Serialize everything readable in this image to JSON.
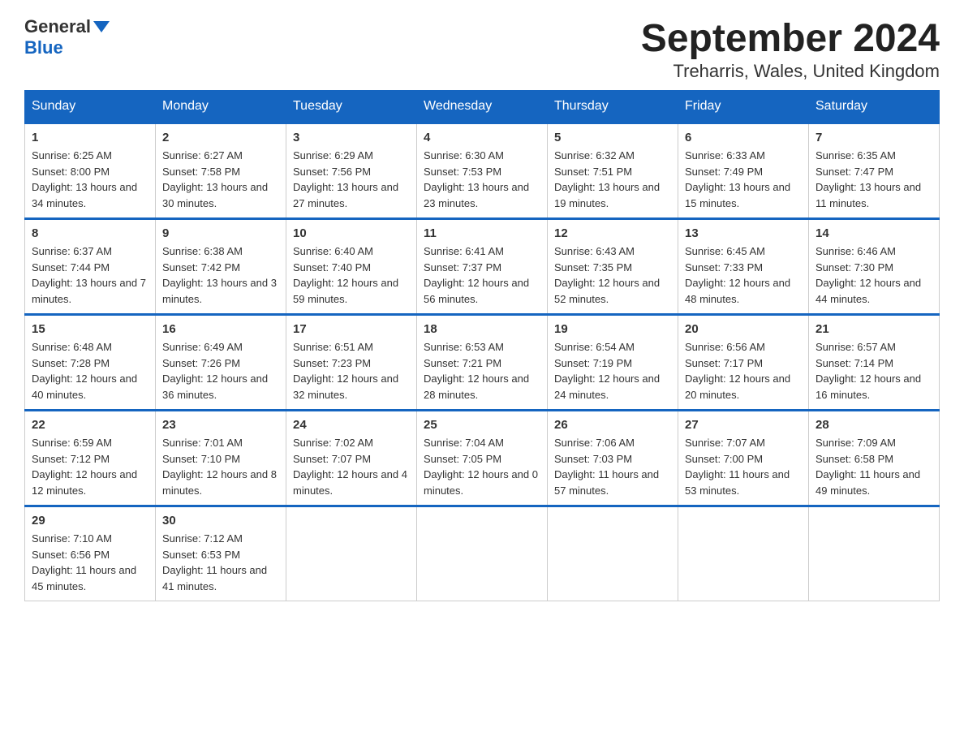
{
  "logo": {
    "general": "General",
    "blue": "Blue"
  },
  "title": "September 2024",
  "subtitle": "Treharris, Wales, United Kingdom",
  "weekdays": [
    "Sunday",
    "Monday",
    "Tuesday",
    "Wednesday",
    "Thursday",
    "Friday",
    "Saturday"
  ],
  "weeks": [
    [
      {
        "day": "1",
        "sunrise": "6:25 AM",
        "sunset": "8:00 PM",
        "daylight": "13 hours and 34 minutes."
      },
      {
        "day": "2",
        "sunrise": "6:27 AM",
        "sunset": "7:58 PM",
        "daylight": "13 hours and 30 minutes."
      },
      {
        "day": "3",
        "sunrise": "6:29 AM",
        "sunset": "7:56 PM",
        "daylight": "13 hours and 27 minutes."
      },
      {
        "day": "4",
        "sunrise": "6:30 AM",
        "sunset": "7:53 PM",
        "daylight": "13 hours and 23 minutes."
      },
      {
        "day": "5",
        "sunrise": "6:32 AM",
        "sunset": "7:51 PM",
        "daylight": "13 hours and 19 minutes."
      },
      {
        "day": "6",
        "sunrise": "6:33 AM",
        "sunset": "7:49 PM",
        "daylight": "13 hours and 15 minutes."
      },
      {
        "day": "7",
        "sunrise": "6:35 AM",
        "sunset": "7:47 PM",
        "daylight": "13 hours and 11 minutes."
      }
    ],
    [
      {
        "day": "8",
        "sunrise": "6:37 AM",
        "sunset": "7:44 PM",
        "daylight": "13 hours and 7 minutes."
      },
      {
        "day": "9",
        "sunrise": "6:38 AM",
        "sunset": "7:42 PM",
        "daylight": "13 hours and 3 minutes."
      },
      {
        "day": "10",
        "sunrise": "6:40 AM",
        "sunset": "7:40 PM",
        "daylight": "12 hours and 59 minutes."
      },
      {
        "day": "11",
        "sunrise": "6:41 AM",
        "sunset": "7:37 PM",
        "daylight": "12 hours and 56 minutes."
      },
      {
        "day": "12",
        "sunrise": "6:43 AM",
        "sunset": "7:35 PM",
        "daylight": "12 hours and 52 minutes."
      },
      {
        "day": "13",
        "sunrise": "6:45 AM",
        "sunset": "7:33 PM",
        "daylight": "12 hours and 48 minutes."
      },
      {
        "day": "14",
        "sunrise": "6:46 AM",
        "sunset": "7:30 PM",
        "daylight": "12 hours and 44 minutes."
      }
    ],
    [
      {
        "day": "15",
        "sunrise": "6:48 AM",
        "sunset": "7:28 PM",
        "daylight": "12 hours and 40 minutes."
      },
      {
        "day": "16",
        "sunrise": "6:49 AM",
        "sunset": "7:26 PM",
        "daylight": "12 hours and 36 minutes."
      },
      {
        "day": "17",
        "sunrise": "6:51 AM",
        "sunset": "7:23 PM",
        "daylight": "12 hours and 32 minutes."
      },
      {
        "day": "18",
        "sunrise": "6:53 AM",
        "sunset": "7:21 PM",
        "daylight": "12 hours and 28 minutes."
      },
      {
        "day": "19",
        "sunrise": "6:54 AM",
        "sunset": "7:19 PM",
        "daylight": "12 hours and 24 minutes."
      },
      {
        "day": "20",
        "sunrise": "6:56 AM",
        "sunset": "7:17 PM",
        "daylight": "12 hours and 20 minutes."
      },
      {
        "day": "21",
        "sunrise": "6:57 AM",
        "sunset": "7:14 PM",
        "daylight": "12 hours and 16 minutes."
      }
    ],
    [
      {
        "day": "22",
        "sunrise": "6:59 AM",
        "sunset": "7:12 PM",
        "daylight": "12 hours and 12 minutes."
      },
      {
        "day": "23",
        "sunrise": "7:01 AM",
        "sunset": "7:10 PM",
        "daylight": "12 hours and 8 minutes."
      },
      {
        "day": "24",
        "sunrise": "7:02 AM",
        "sunset": "7:07 PM",
        "daylight": "12 hours and 4 minutes."
      },
      {
        "day": "25",
        "sunrise": "7:04 AM",
        "sunset": "7:05 PM",
        "daylight": "12 hours and 0 minutes."
      },
      {
        "day": "26",
        "sunrise": "7:06 AM",
        "sunset": "7:03 PM",
        "daylight": "11 hours and 57 minutes."
      },
      {
        "day": "27",
        "sunrise": "7:07 AM",
        "sunset": "7:00 PM",
        "daylight": "11 hours and 53 minutes."
      },
      {
        "day": "28",
        "sunrise": "7:09 AM",
        "sunset": "6:58 PM",
        "daylight": "11 hours and 49 minutes."
      }
    ],
    [
      {
        "day": "29",
        "sunrise": "7:10 AM",
        "sunset": "6:56 PM",
        "daylight": "11 hours and 45 minutes."
      },
      {
        "day": "30",
        "sunrise": "7:12 AM",
        "sunset": "6:53 PM",
        "daylight": "11 hours and 41 minutes."
      },
      null,
      null,
      null,
      null,
      null
    ]
  ],
  "labels": {
    "sunrise": "Sunrise:",
    "sunset": "Sunset:",
    "daylight": "Daylight:"
  }
}
